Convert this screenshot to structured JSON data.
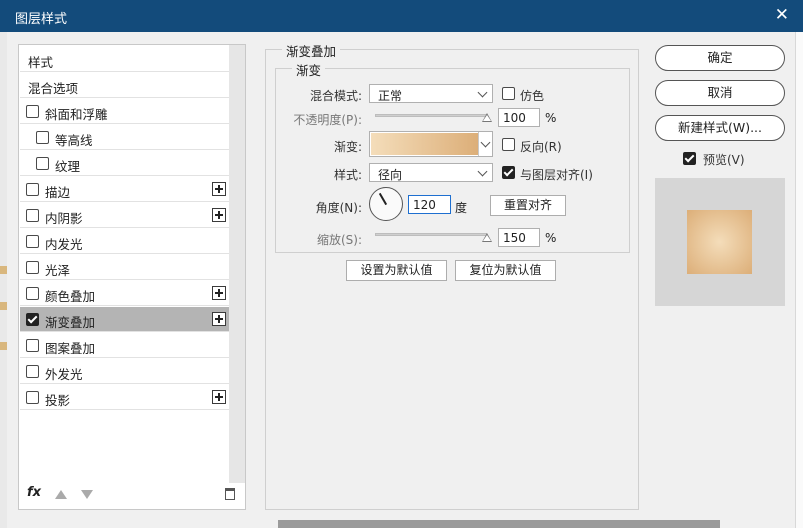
{
  "window": {
    "title": "图层样式",
    "close_glyph": "✕"
  },
  "style_list": {
    "header": "样式",
    "blend_options": "混合选项",
    "items": [
      {
        "label": "斜面和浮雕",
        "checked": false,
        "has_plus": false,
        "indent": false
      },
      {
        "label": "等高线",
        "checked": false,
        "has_plus": false,
        "indent": true
      },
      {
        "label": "纹理",
        "checked": false,
        "has_plus": false,
        "indent": true
      },
      {
        "label": "描边",
        "checked": false,
        "has_plus": true,
        "indent": false
      },
      {
        "label": "内阴影",
        "checked": false,
        "has_plus": true,
        "indent": false
      },
      {
        "label": "内发光",
        "checked": false,
        "has_plus": false,
        "indent": false
      },
      {
        "label": "光泽",
        "checked": false,
        "has_plus": false,
        "indent": false
      },
      {
        "label": "颜色叠加",
        "checked": false,
        "has_plus": true,
        "indent": false
      },
      {
        "label": "渐变叠加",
        "checked": true,
        "has_plus": true,
        "indent": false,
        "selected": true
      },
      {
        "label": "图案叠加",
        "checked": false,
        "has_plus": false,
        "indent": false
      },
      {
        "label": "外发光",
        "checked": false,
        "has_plus": false,
        "indent": false
      },
      {
        "label": "投影",
        "checked": false,
        "has_plus": true,
        "indent": false
      }
    ],
    "footer": {
      "fx_label": "fx"
    }
  },
  "gradient_overlay": {
    "group_title": "渐变叠加",
    "subgroup_title": "渐变",
    "blend_mode_label": "混合模式:",
    "blend_mode_value": "正常",
    "dither_label": "仿色",
    "dither_checked": false,
    "opacity_label": "不透明度(P):",
    "opacity_value": "100",
    "opacity_fraction": 1.0,
    "opacity_unit": "%",
    "gradient_label": "渐变:",
    "gradient_colors": [
      "#f4ddba",
      "#dcae78"
    ],
    "reverse_label": "反向(R)",
    "reverse_checked": false,
    "style_label": "样式:",
    "style_value": "径向",
    "align_label": "与图层对齐(I)",
    "align_checked": true,
    "angle_label": "角度(N):",
    "angle_value": "120",
    "angle_degrees": 120,
    "angle_unit": "度",
    "reset_align_label": "重置对齐",
    "scale_label": "缩放(S):",
    "scale_value": "150",
    "scale_fraction": 1.0,
    "scale_unit": "%",
    "set_default_label": "设置为默认值",
    "reset_default_label": "复位为默认值"
  },
  "actions": {
    "ok_label": "确定",
    "cancel_label": "取消",
    "new_style_label": "新建样式(W)...",
    "preview_label": "预览(V)",
    "preview_checked": true
  },
  "colors": {
    "titlebar": "#134b7b",
    "selected_row": "#b4b4b4",
    "gradient_light": "#f4ddba",
    "gradient_dark": "#dcae78"
  }
}
